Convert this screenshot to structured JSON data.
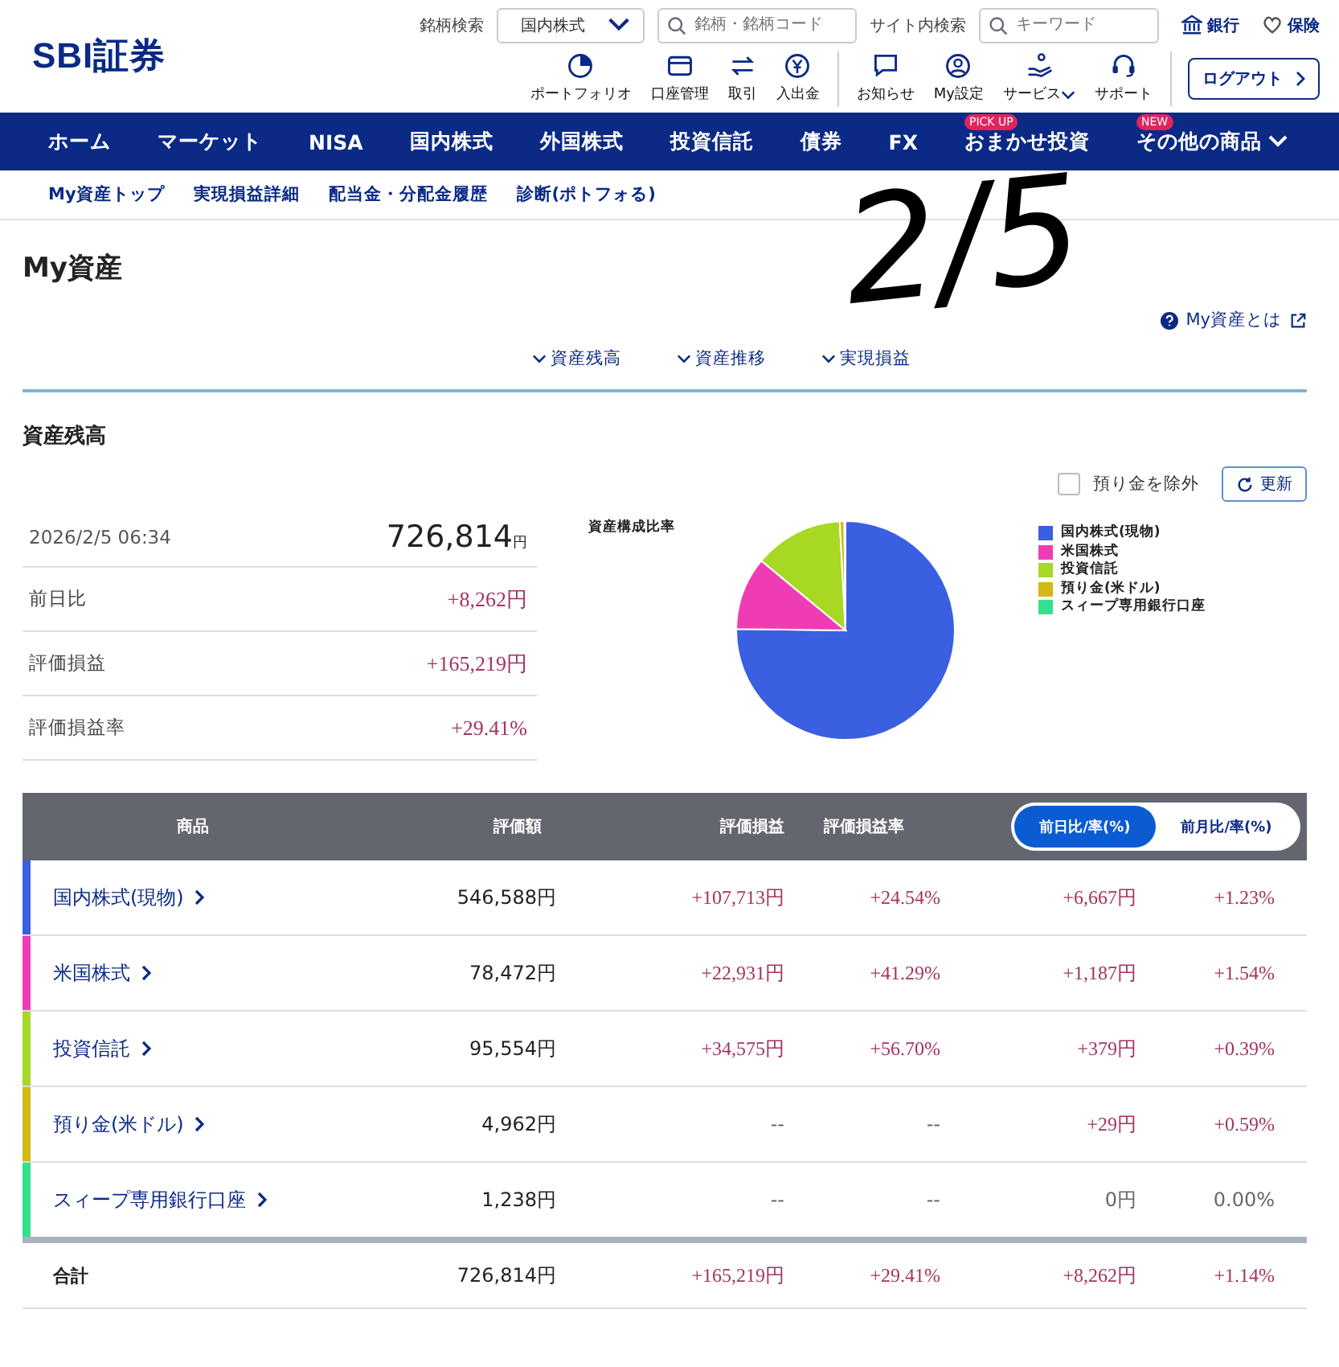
{
  "header": {
    "logo": "SBI証券",
    "stock_search_label": "銘柄検索",
    "market_select": "国内株式",
    "stock_search_placeholder": "銘柄・銘柄コード",
    "site_search_label": "サイト内検索",
    "site_search_placeholder": "キーワード",
    "links": [
      {
        "kind": "bank",
        "label": "銀行"
      },
      {
        "kind": "insurance",
        "label": "保険"
      }
    ],
    "tools": [
      {
        "kind": "portfolio",
        "label": "ポートフォリオ"
      },
      {
        "kind": "account",
        "label": "口座管理"
      },
      {
        "kind": "trade",
        "label": "取引"
      },
      {
        "kind": "deposit",
        "label": "入出金"
      },
      {
        "kind": "notice",
        "label": "お知らせ"
      },
      {
        "kind": "settings",
        "label": "My設定"
      },
      {
        "kind": "service",
        "label": "サービス"
      },
      {
        "kind": "support",
        "label": "サポート"
      }
    ],
    "logout": "ログアウト"
  },
  "nav": [
    {
      "label": "ホーム"
    },
    {
      "label": "マーケット"
    },
    {
      "label": "NISA"
    },
    {
      "label": "国内株式"
    },
    {
      "label": "外国株式"
    },
    {
      "label": "投資信託"
    },
    {
      "label": "債券"
    },
    {
      "label": "FX"
    },
    {
      "label": "おまかせ投資",
      "badge": "PICK UP"
    },
    {
      "label": "その他の商品",
      "badge": "NEW"
    }
  ],
  "subnav": [
    "My資産トップ",
    "実現損益詳細",
    "配当金・分配金履歴",
    "診断(ポトフォる)"
  ],
  "annotation": "2/5",
  "page_title": "My資産",
  "help_link": "My資産とは",
  "anchors": [
    "資産残高",
    "資産推移",
    "実現損益"
  ],
  "section_title": "資産残高",
  "exclude_deposit": {
    "label": "預り金を除外",
    "checked": false
  },
  "refresh": "更新",
  "summary": {
    "datetime": "2026/2/5 06:34",
    "total": "726,814",
    "unit": "円",
    "rows": [
      {
        "label": "前日比",
        "value": "+8,262円"
      },
      {
        "label": "評価損益",
        "value": "+165,219円"
      },
      {
        "label": "評価損益率",
        "value": "+29.41%"
      }
    ]
  },
  "chart_data": {
    "type": "pie",
    "title": "資産構成比率",
    "legend": "right",
    "categories": [
      "国内株式(現物)",
      "米国株式",
      "投資信託",
      "預り金(米ドル)",
      "スィープ専用銀行口座"
    ],
    "series": [
      {
        "values": [
          75.2,
          10.8,
          13.15,
          0.68,
          0.17
        ]
      }
    ],
    "colors": [
      "#3a5fe0",
      "#f03cb4",
      "#a6d824",
      "#d4b814",
      "#34e08c"
    ]
  },
  "table": {
    "columns": [
      "商品",
      "評価額",
      "評価損益",
      "評価損益率"
    ],
    "toggle": [
      {
        "label": "前日比/率(%)",
        "selected": true
      },
      {
        "label": "前月比/率(%)",
        "selected": false
      }
    ],
    "rows": [
      {
        "color": "#3a5fe0",
        "cells": [
          {
            "text": "国内株式(現物)",
            "up": false
          },
          {
            "text": "546,588円",
            "up": false
          },
          {
            "text": "+107,713円",
            "up": true
          },
          {
            "text": "+24.54%",
            "up": true
          },
          {
            "text": "+6,667円",
            "up": true
          },
          {
            "text": "+1.23%",
            "up": true
          }
        ]
      },
      {
        "color": "#f03cb4",
        "cells": [
          {
            "text": "米国株式",
            "up": false
          },
          {
            "text": "78,472円",
            "up": false
          },
          {
            "text": "+22,931円",
            "up": true
          },
          {
            "text": "+41.29%",
            "up": true
          },
          {
            "text": "+1,187円",
            "up": true
          },
          {
            "text": "+1.54%",
            "up": true
          }
        ]
      },
      {
        "color": "#a6d824",
        "cells": [
          {
            "text": "投資信託",
            "up": false
          },
          {
            "text": "95,554円",
            "up": false
          },
          {
            "text": "+34,575円",
            "up": true
          },
          {
            "text": "+56.70%",
            "up": true
          },
          {
            "text": "+379円",
            "up": true
          },
          {
            "text": "+0.39%",
            "up": true
          }
        ]
      },
      {
        "color": "#d4b814",
        "cells": [
          {
            "text": "預り金(米ドル)",
            "up": false
          },
          {
            "text": "4,962円",
            "up": false
          },
          {
            "text": "--",
            "up": false
          },
          {
            "text": "--",
            "up": false
          },
          {
            "text": "+29円",
            "up": true
          },
          {
            "text": "+0.59%",
            "up": true
          }
        ]
      },
      {
        "color": "#34e08c",
        "cells": [
          {
            "text": "スィープ専用銀行口座",
            "up": false
          },
          {
            "text": "1,238円",
            "up": false
          },
          {
            "text": "--",
            "up": false
          },
          {
            "text": "--",
            "up": false
          },
          {
            "text": "0円",
            "up": false
          },
          {
            "text": "0.00%",
            "up": false
          }
        ]
      }
    ],
    "total": {
      "cells": [
        {
          "text": "合計",
          "up": false
        },
        {
          "text": "726,814円",
          "up": false
        },
        {
          "text": "+165,219円",
          "up": true
        },
        {
          "text": "+29.41%",
          "up": true
        },
        {
          "text": "+8,262円",
          "up": true
        },
        {
          "text": "+1.14%",
          "up": true
        }
      ]
    }
  }
}
